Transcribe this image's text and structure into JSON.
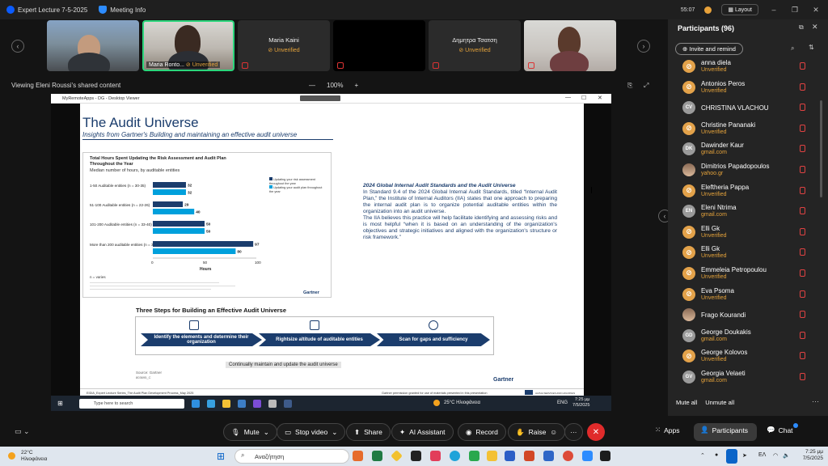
{
  "titlebar": {
    "app_name": "Expert Lecture 7-5-2025",
    "meeting_info": "Meeting Info",
    "time": "55:07",
    "layout_label": "Layout"
  },
  "video_tiles": [
    {
      "name": "",
      "status": ""
    },
    {
      "name": "Maria Ronto...",
      "status": "Unverified"
    },
    {
      "name": "Maria Kaini",
      "status": "Unverified"
    },
    {
      "name": "",
      "status": ""
    },
    {
      "name": "Δημητρα Τσατση",
      "status": "Unverified"
    },
    {
      "name": "",
      "status": ""
    }
  ],
  "share": {
    "viewing_label": "Viewing Eleni Roussi's shared content",
    "zoom_minus": "—",
    "zoom_level": "100%",
    "zoom_plus": "+"
  },
  "viewer": {
    "title": "MyRemoteApps - DG - Desktop Viewer"
  },
  "slide": {
    "title": "The Audit Universe",
    "subtitle": "Insights from Gartner's Building and maintaining an effective audit universe",
    "chart_title": "Total Hours Spent Updating the Risk Assessment and Audit Plan Throughout the Year",
    "chart_subtitle": "Median number of hours, by auditable entities",
    "legend_1": "Updating your risk assessment throughout the year",
    "legend_2": "Updating your audit plan throughout the year",
    "n_varies": "n = varies",
    "chart_brand": "Gartner",
    "xlabel": "Hours",
    "right_head": "2024 Global Internal Audit Standards and the Audit Universe",
    "right_p1": "In Standard 9.4 of the 2024 Global Internal Audit Standards, titled “Internal Audit Plan,” the Institute of Internal Auditors (IIA) states that one approach to preparing the internal audit plan is to organize potential auditable entities within the organization into an audit universe.",
    "right_p2": "The IIA believes this practice will help facilitate identifying and assessing risks and is most helpful “when it is based on an understanding of the organization's objectives and strategic initiatives and aligned with the organization's structure or risk framework.”",
    "steps_title": "Three Steps for Building an Effective Audit Universe",
    "step_1": "Identify the elements and determine their organization",
    "step_2": "Rightsize altitude of auditable entities",
    "step_3": "Scan for gaps and sufficiency",
    "continual": "Continually maintain and update the audit universe",
    "source": "Source: Gartner",
    "source_id": "803695_C",
    "brand": "Gartner",
    "footer_left": "EIDIA_Expert Lecture Series_The Audit Plan Development Process_May 2025",
    "footer_mid": "Gartner permission granted for use of materials presented in this presentation",
    "footer_right": "ALPHA SERVICES AND HOLDINGS"
  },
  "chart_data": {
    "type": "bar",
    "title": "Total Hours Spent Updating the Risk Assessment and Audit Plan Throughout the Year",
    "subtitle": "Median number of hours, by auditable entities",
    "categories": [
      "1-50 Auditable entities (n = 30-35)",
      "51-100 Auditable entities (n = 22-26)",
      "101-200 Auditable entities (n = 33-40)",
      "More than 200 auditable entities (n = 32-35)"
    ],
    "series": [
      {
        "name": "Updating your risk assessment throughout the year",
        "values": [
          32,
          29,
          50,
          97
        ],
        "color": "#1b3d6d"
      },
      {
        "name": "Updating your audit plan throughout the year",
        "values": [
          32,
          40,
          50,
          80
        ],
        "color": "#00a0dc"
      }
    ],
    "xlabel": "Hours",
    "ylabel": "",
    "xlim": [
      0,
      100
    ],
    "ticks": [
      "0",
      "50",
      "100"
    ]
  },
  "inner_taskbar": {
    "search_placeholder": "Type here to search",
    "weather": "25°C Ηλιοφάνεια",
    "lang": "ENG",
    "time": "7:25 μμ",
    "date": "7/5/2025"
  },
  "panel": {
    "title": "Participants (96)",
    "invite_label": "Invite and remind",
    "mute_all": "Mute all",
    "unmute_all": "Unmute all",
    "participants": [
      {
        "name": "anna diela",
        "sub": "Unverified",
        "initials": "",
        "avatar": "orange"
      },
      {
        "name": "Antonios Peros",
        "sub": "Unverified",
        "initials": "",
        "avatar": "orange"
      },
      {
        "name": "CHRISTINA VLACHOU",
        "sub": "",
        "initials": "CV",
        "avatar": "grey"
      },
      {
        "name": "Christine Pananaki",
        "sub": "Unverified",
        "initials": "",
        "avatar": "orange"
      },
      {
        "name": "Dawinder Kaur",
        "sub": "gmail.com",
        "initials": "DK",
        "avatar": "grey"
      },
      {
        "name": "Dimitrios Papadopoulos",
        "sub": "yahoo.gr",
        "initials": "",
        "avatar": "photo"
      },
      {
        "name": "Eleftheria Pappa",
        "sub": "Unverified",
        "initials": "",
        "avatar": "orange"
      },
      {
        "name": "Eleni Ntrima",
        "sub": "gmail.com",
        "initials": "EN",
        "avatar": "grey"
      },
      {
        "name": "Elli Gk",
        "sub": "Unverified",
        "initials": "",
        "avatar": "orange"
      },
      {
        "name": "Elli Gk",
        "sub": "Unverified",
        "initials": "",
        "avatar": "orange"
      },
      {
        "name": "Emmeleia Petropoulou",
        "sub": "Unverified",
        "initials": "",
        "avatar": "orange"
      },
      {
        "name": "Eva Psoma",
        "sub": "Unverified",
        "initials": "",
        "avatar": "orange"
      },
      {
        "name": "Frago Kourandi",
        "sub": "",
        "initials": "",
        "avatar": "photo"
      },
      {
        "name": "George Doukakis",
        "sub": "gmail.com",
        "initials": "GD",
        "avatar": "grey"
      },
      {
        "name": "George Kolovos",
        "sub": "Unverified",
        "initials": "",
        "avatar": "orange"
      },
      {
        "name": "Georgia Velaeti",
        "sub": "gmail.com",
        "initials": "GV",
        "avatar": "grey"
      }
    ]
  },
  "toolbar": {
    "mute": "Mute",
    "stop_video": "Stop video",
    "share": "Share",
    "ai_assistant": "AI Assistant",
    "record": "Record",
    "raise": "Raise",
    "more": "···",
    "leave": "✕",
    "apps": "Apps",
    "participants": "Participants",
    "chat": "Chat"
  },
  "windows_taskbar": {
    "temp": "22°C",
    "weather_text": "Ηλιοφάνεια",
    "search_placeholder": "Αναζήτηση",
    "lang": "ΕΛ",
    "time": "7:25 μμ",
    "date": "7/5/2025"
  },
  "colors": {
    "zoom_blue": "#0b5cff",
    "unverified": "#e5a33b",
    "leave_red": "#e02b2b",
    "slide_navy": "#1b3d6d",
    "slide_cyan": "#00a0dc"
  }
}
